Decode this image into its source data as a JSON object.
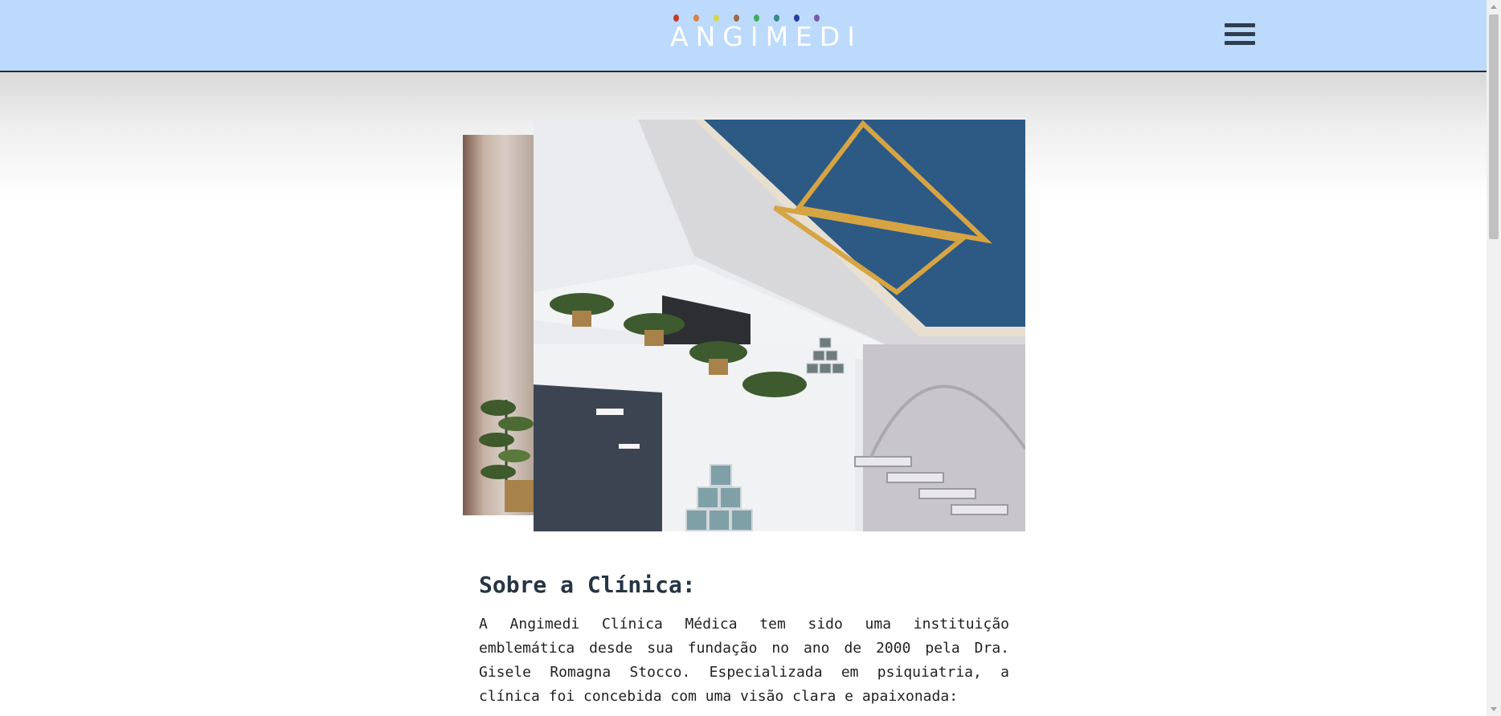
{
  "header": {
    "brand": "ANGIMEDI",
    "brand_dot_colors": [
      "#c0392b",
      "#d9824a",
      "#d8d44a",
      "#9b6a4a",
      "#3cae5a",
      "#3a8a8a",
      "#2a3f9a",
      "#7c5aa8"
    ],
    "background_color": "#bcdafc",
    "menu_icon": "hamburger-menu-icon"
  },
  "gallery": {
    "main_image": "clinic-interior-star-ceiling",
    "side_image": "clinic-interior-plants"
  },
  "about": {
    "title": "Sobre a Clínica:",
    "body": "A Angimedi Clínica Médica tem sido uma instituição emblemática desde sua fundação no ano de 2000 pela Dra. Gisele Romagna Stocco. Especializada em psiquiatria, a clínica foi concebida com uma visão clara e apaixonada:"
  },
  "colors": {
    "title_text": "#263545",
    "ceiling_blue": "#2d5985",
    "star_gold": "#d6a443"
  }
}
